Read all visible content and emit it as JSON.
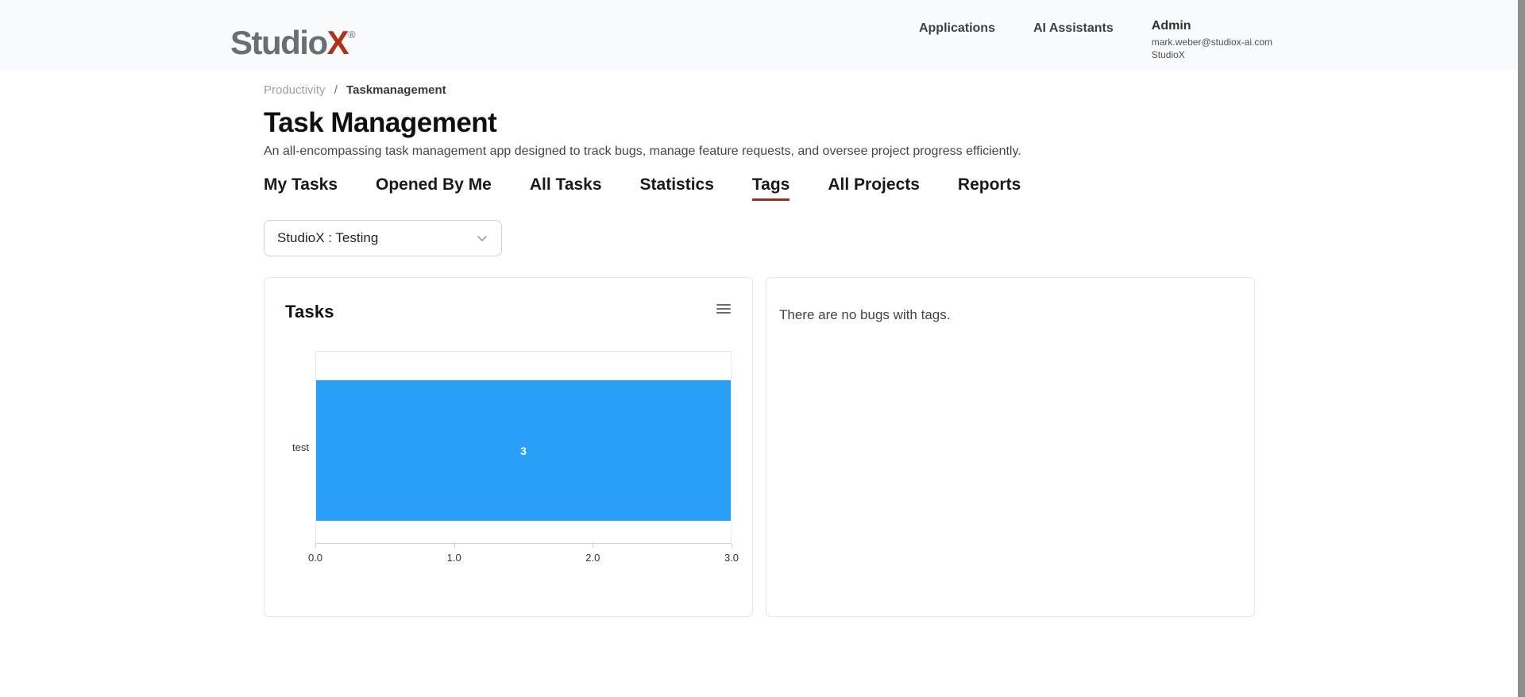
{
  "colors": {
    "accent-red": "#b23119",
    "tab-underline": "#943226",
    "bar-blue": "#2a9ff7"
  },
  "header": {
    "logo": {
      "studio": "Studio",
      "x": "X",
      "reg": "®"
    },
    "nav": [
      {
        "label": "Applications"
      },
      {
        "label": "AI Assistants"
      }
    ],
    "user": {
      "name": "Admin",
      "email": "mark.weber@studiox-ai.com",
      "org": "StudioX"
    }
  },
  "breadcrumb": {
    "parent": "Productivity",
    "separator": "/",
    "current": "Taskmanagement"
  },
  "page": {
    "title": "Task Management",
    "subtitle": "An all-encompassing task management app designed to track bugs, manage feature requests, and oversee project progress efficiently."
  },
  "tabs": [
    {
      "label": "My Tasks",
      "active": false
    },
    {
      "label": "Opened By Me",
      "active": false
    },
    {
      "label": "All Tasks",
      "active": false
    },
    {
      "label": "Statistics",
      "active": false
    },
    {
      "label": "Tags",
      "active": true
    },
    {
      "label": "All Projects",
      "active": false
    },
    {
      "label": "Reports",
      "active": false
    }
  ],
  "filter": {
    "selected": "StudioX : Testing"
  },
  "tasks_card": {
    "title": "Tasks",
    "menu_icon": "hamburger-icon"
  },
  "empty_card": {
    "message": "There are no bugs with tags."
  },
  "chart_data": {
    "type": "bar",
    "orientation": "horizontal",
    "title": "Tasks",
    "categories": [
      "test"
    ],
    "values": [
      3
    ],
    "data_labels": [
      "3"
    ],
    "xlim": [
      0,
      3
    ],
    "x_ticks": [
      "0.0",
      "1.0",
      "2.0",
      "3.0"
    ],
    "xlabel": "",
    "ylabel": "",
    "grid": false,
    "legend": false,
    "bar_color": "#2a9ff7"
  }
}
